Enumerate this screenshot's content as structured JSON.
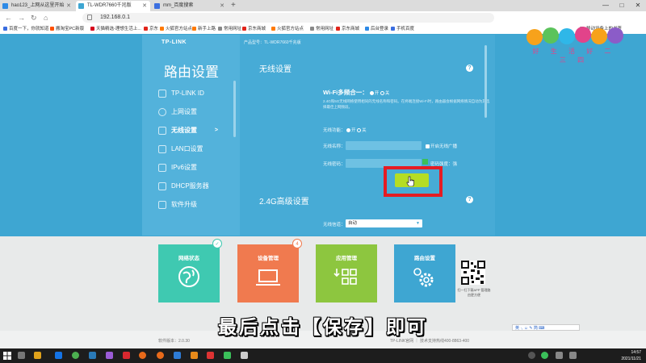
{
  "browser": {
    "tabs": [
      {
        "title": "hao123_上网从这里开始",
        "active": false
      },
      {
        "title": "TL-WDR7660千兆版",
        "active": true
      },
      {
        "title": "mm_百度搜索",
        "active": false
      }
    ],
    "new_tab": "+",
    "url": "192.168.0.1",
    "bookmarks": [
      "百度一下，你就知道",
      "搬淘宝PC新版",
      "天猫精选-理想生活上...",
      "京东",
      "火狐官方站点",
      "新手上路",
      "常用网址",
      "京东商城",
      "火狐官方站点",
      "常用网址",
      "京东商城",
      "后台登录",
      "手机百度"
    ],
    "bookmarks_right": "移动设备上的书签",
    "window_controls": [
      "—",
      "□",
      "✕"
    ]
  },
  "router": {
    "brand": "TP-LINK",
    "model": "产品型号：TL-WDR7660千兆版",
    "sidebar_title": "路由设置",
    "sidebar_items": [
      {
        "label": "TP-LINK ID",
        "icon": "id-icon"
      },
      {
        "label": "上网设置",
        "icon": "globe-icon"
      },
      {
        "label": "无线设置",
        "icon": "wifi-icon",
        "active": true,
        "chevron": ">"
      },
      {
        "label": "LAN口设置",
        "icon": "lan-icon"
      },
      {
        "label": "IPv6设置",
        "icon": "ipv6-icon"
      },
      {
        "label": "DHCP服务器",
        "icon": "dhcp-icon"
      },
      {
        "label": "软件升级",
        "icon": "upgrade-icon"
      }
    ],
    "wireless": {
      "title": "无线设置",
      "help": "?",
      "wifi_multi_label": "Wi-Fi多频合一：",
      "on": "开",
      "off": "关",
      "description": "2.4G和5G无线网络使用相同的无线名称和密码。在终端连接Wi-Fi时，路由器会根据网络情况自动为其选择最佳上网频段。",
      "radio_label": "无线功能：",
      "ssid_label": "无线名称：",
      "hide_ssid": "开启无线广播",
      "password_label": "无线密码：",
      "password_strength": "密码强度：",
      "strength_value": "强"
    },
    "advanced": {
      "title": "2.4G高级设置",
      "help": "?",
      "channel_label": "无线信道：",
      "channel_value": "自动"
    }
  },
  "tiles": [
    {
      "label": "网络状态",
      "color": "#3fc9b1",
      "badge": "✓"
    },
    {
      "label": "设备管理",
      "color": "#f07a4f",
      "badge": "4"
    },
    {
      "label": "应用管理",
      "color": "#8dc63f"
    },
    {
      "label": "路由设置",
      "color": "#3ea6d2"
    }
  ],
  "qr_caption": "扫一扫下载APP 管理路由更方便",
  "subtitle": "最后点击【保存】即可",
  "footer": {
    "version": "软件版本：2.0.30",
    "support": "TP-LINK官网 ｜ 技术支持热线400-8863-400"
  },
  "ime": "英 ·, ☺ ✎ 简 ⌨",
  "watermark": {
    "text": "好 生 活 好 二 三 四"
  },
  "taskbar": {
    "time": "14:57",
    "date": "2021/11/21"
  }
}
